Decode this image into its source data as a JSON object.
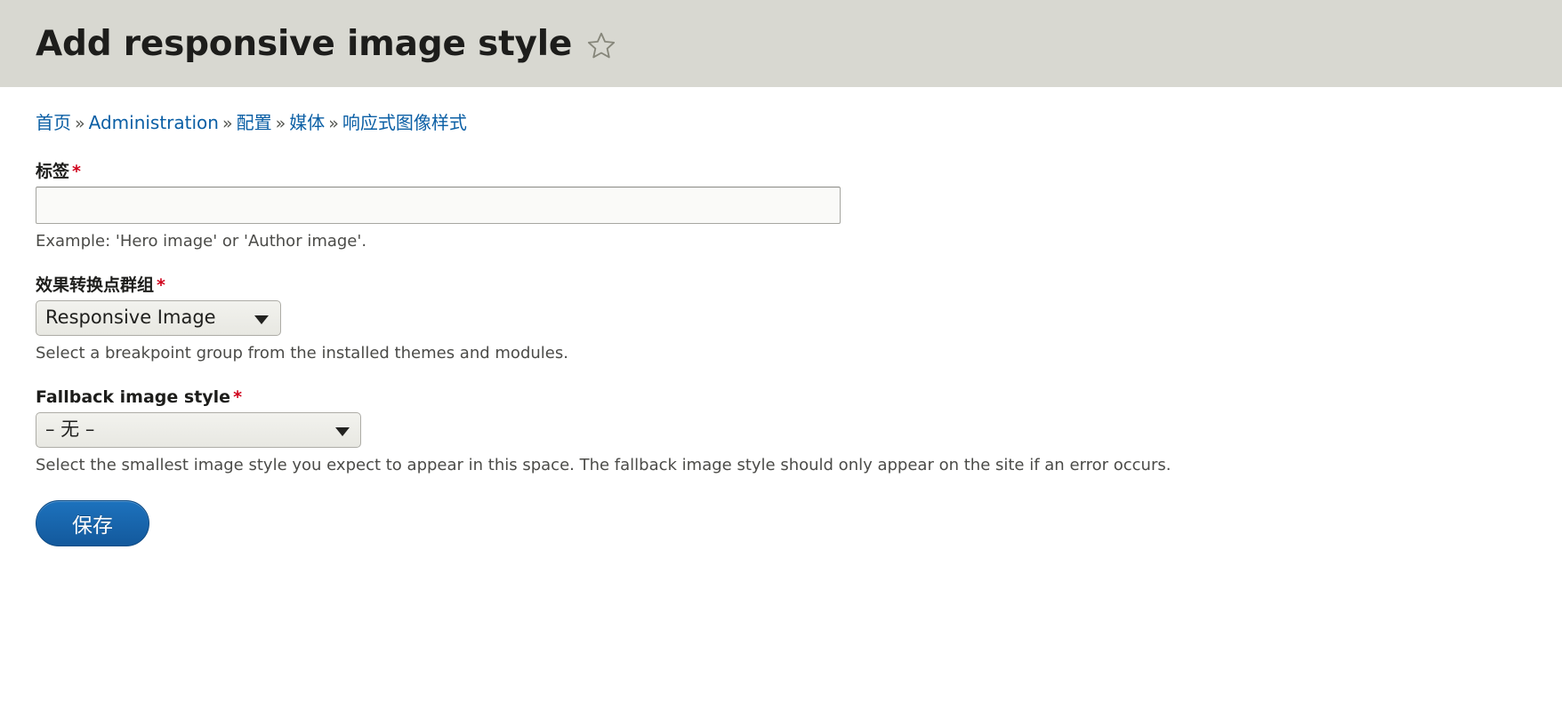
{
  "header": {
    "title": "Add responsive image style",
    "star_icon": "star-outline-icon"
  },
  "breadcrumb": {
    "separator": "»",
    "items": [
      {
        "label": "首页"
      },
      {
        "label": "Administration"
      },
      {
        "label": "配置"
      },
      {
        "label": "媒体"
      },
      {
        "label": "响应式图像样式"
      }
    ]
  },
  "form": {
    "label_field": {
      "label": "标签",
      "required_mark": "*",
      "value": "",
      "placeholder": "",
      "description": "Example: 'Hero image' or 'Author image'."
    },
    "breakpoint_group": {
      "label": "效果转换点群组",
      "required_mark": "*",
      "selected": "Responsive Image",
      "options": [
        "Responsive Image"
      ],
      "description": "Select a breakpoint group from the installed themes and modules."
    },
    "fallback_image_style": {
      "label": "Fallback image style",
      "required_mark": "*",
      "selected": "– 无 –",
      "options": [
        "– 无 –"
      ],
      "description": "Select the smallest image style you expect to appear in this space. The fallback image style should only appear on the site if an error occurs."
    },
    "actions": {
      "save_label": "保存"
    }
  },
  "colors": {
    "header_bg": "#d8d8d1",
    "link": "#0b5fa5",
    "required": "#d0021b",
    "primary_button": "#1d72bd",
    "text": "#1d1d1b"
  }
}
